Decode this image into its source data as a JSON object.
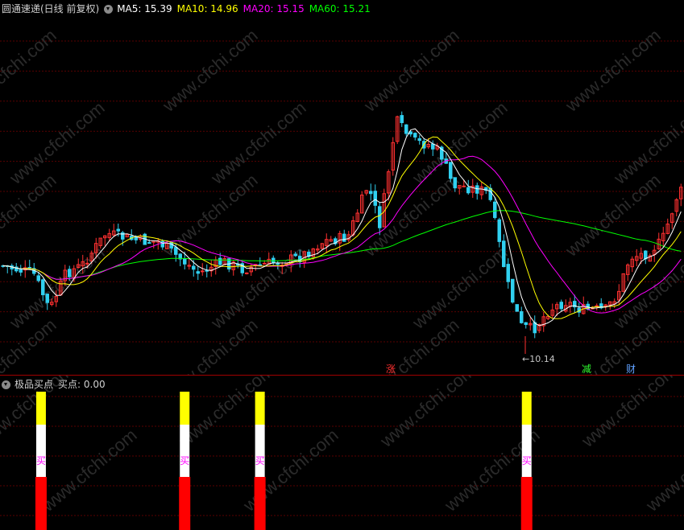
{
  "header": {
    "title": "圆通速递(日线 前复权)",
    "ma5_label": "MA5: 15.39",
    "ma10_label": "MA10: 14.96",
    "ma20_label": "MA20: 15.15",
    "ma60_label": "MA60: 15.21"
  },
  "colors": {
    "bg": "#000000",
    "grid": "#5a0000",
    "up": "#ff3030",
    "down": "#30d0f0",
    "ma5": "#ffffff",
    "ma10": "#ffff00",
    "ma20": "#ff00ff",
    "ma60": "#00ff00"
  },
  "main_chart": {
    "low_label": "10.14",
    "events": [
      {
        "text": "涨",
        "color": "#ff3030"
      },
      {
        "text": "减",
        "color": "#30ff30"
      },
      {
        "text": "财",
        "color": "#60a0ff"
      }
    ]
  },
  "indicator": {
    "title": "极品买点",
    "value_label": "买点: 0.00",
    "signal_text": "买",
    "signals": [
      {
        "bar": 0.06
      },
      {
        "bar": 0.27
      },
      {
        "bar": 0.38
      },
      {
        "bar": 0.77
      }
    ]
  },
  "watermark": "www.cfchi.com"
}
